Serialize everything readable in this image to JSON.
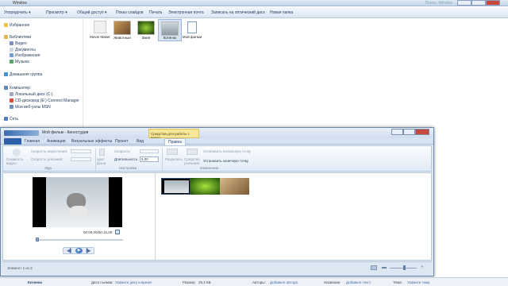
{
  "explorer": {
    "title": "Window",
    "search_placeholder": "Поиск: Window",
    "toolbar": [
      "Упорядочить ▾",
      "Просмотр ▾",
      "Общий доступ ▾",
      "Показ слайдов",
      "Печать",
      "Электронная почта",
      "Записать на оптический диск",
      "Новая папка"
    ],
    "nav": {
      "favorites": "Избранное",
      "libraries": "Библиотеки",
      "lib_items": [
        "Видео",
        "Документы",
        "Изображения",
        "Музыка"
      ],
      "homegroup": "Домашняя группа",
      "computer": "Компьютер",
      "drives": [
        "Локальный диск (C:)",
        "CD-дисковод (E:) Connect Manager",
        "Мои веб-узлы MSN"
      ],
      "network": "Сеть"
    },
    "files": [
      "Movie Maker",
      "Животные",
      "Змея",
      "Котенок",
      "Мой фильм"
    ],
    "details": {
      "name": "Котенок",
      "date_label": "Дата съемки:",
      "date_value": "Укажите дату и время",
      "size_label": "Размер:",
      "size_value": "29,2 КБ",
      "authors_label": "Авторы:",
      "authors_value": "Добавьте автора",
      "title_label": "Название:",
      "title_value": "Добавьте текст",
      "subject_label": "Тема:",
      "subject_value": "Укажите тему"
    }
  },
  "moviemaker": {
    "title": "Мой фильм - Киностудия",
    "context_tab": "Средства для работы с видео",
    "tabs": [
      "Главная",
      "Анимация",
      "Визуальные эффекты",
      "Проект",
      "Вид",
      "Правка"
    ],
    "ribbon": {
      "sound_items": [
        "Громкость видео",
        "Скорость нарастания:",
        "Скорость угасания:"
      ],
      "settings_items": [
        "Цвет фона",
        "Скорость:",
        "Длительность:"
      ],
      "duration_value": "5,00",
      "edit_items": [
        "Разделить",
        "Средство усечения",
        "Установить начальную точку",
        "Установить конечную точку"
      ],
      "groups": [
        "Звук",
        "Настройка",
        "Изменение"
      ]
    },
    "preview_time": "00:00,00/00:15,00",
    "status": "Элемент 1 из 3"
  }
}
